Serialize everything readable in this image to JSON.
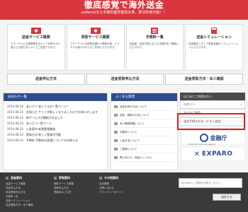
{
  "hero": {
    "title": "徹底感覚で海外送金",
    "subtitle": "enRemitなら手数料業界最低水準、即日利用可能！！"
  },
  "cards": [
    {
      "title": "送金サービス概要",
      "desc": "マネーグラムの提携網を生かして世界200カ国以上の国に低コストでご送金できます。"
    },
    {
      "title": "受取サービス概要",
      "desc": "マネーグラムの提携店舗から受取可能、ビジネスや個人の方でもご利用いただけます。"
    },
    {
      "title": "手数料一覧",
      "desc": "送金額・送金先国に応じた手数料をご確認いただけます。"
    },
    {
      "title": "送金シミュレーション",
      "desc": "送金額を入力して受取金額をシミュレーションいただけます。"
    }
  ],
  "buttons": [
    "送金申込方法",
    "送金受取申込方法",
    "送金受取方法・本人確認"
  ],
  "news": {
    "header": "お知らせ一覧",
    "items": [
      {
        "date": "2014.08.24",
        "text": "あいさつ あいうえお一覧ページ！"
      },
      {
        "date": "2014.08.24",
        "text": "お知らせ サイトが新しくなりましたのでお知らせします"
      },
      {
        "date": "2014.08.24",
        "text": "新サービスが開始されました"
      },
      {
        "date": "2014.08.24",
        "text": "あいさつ一覧ページ"
      },
      {
        "date": "2014.08.24",
        "text": "入金案内 新規登録開始"
      },
      {
        "date": "2014.08.24",
        "text": "登録方法 新しく登録が可能"
      },
      {
        "date": "2014.08.24",
        "text": "手数料 手数料の変更についてのお知らせ"
      }
    ]
  },
  "faq": {
    "header": "よくある質問",
    "items": [
      "送金手続き方法について",
      "送金・受取の方法について",
      "本人確認書類について",
      "手数料について",
      "入金方法について",
      "ご登録について",
      "問い合わせ・送金キャンセル"
    ]
  },
  "side": {
    "header": "はじめてご利用の方へ",
    "login": "ログイン",
    "items": [
      "法人のご利用",
      "送金手続き方法（テスト送金）",
      "よくあるご質問"
    ]
  },
  "logos": {
    "fsa": "金融庁",
    "fsa_sub": "Financial Services Agency",
    "exparo": "EXPARO"
  },
  "footer": {
    "col1": {
      "title": "送金案内",
      "items": [
        "送金サービス概要",
        "送金申込方法",
        "送金受取申込方法",
        "手数料一覧",
        "送金シミュレーション",
        "送金受取方法・本人確認"
      ]
    },
    "col2": {
      "title": "受取案内",
      "items": [
        "受取サービス概要",
        "受取申込方法",
        "受取時のご注意"
      ]
    },
    "col3": {
      "title": "その他案内",
      "items": [
        "会社概要",
        "お問い合わせ",
        "プライバシーポリシー"
      ]
    },
    "newsletter_placeholder": "enremitへご意見をお寄せください",
    "newsletter_button": "送信する"
  },
  "colors": {
    "brand_red": "#d9363e",
    "navy": "#2d4d8c",
    "highlight": "#e01a1a"
  }
}
